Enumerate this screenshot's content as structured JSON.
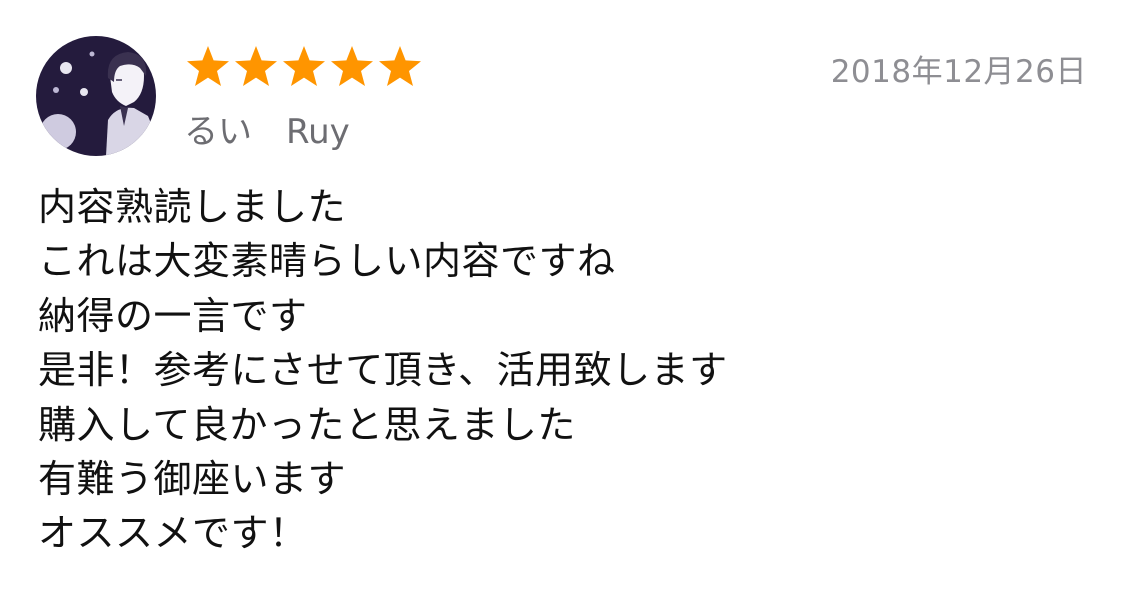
{
  "review": {
    "rating": 5,
    "rating_max": 5,
    "date": "2018年12月26日",
    "reviewer_name": "るい　Ruy",
    "lines": [
      "内容熟読しました",
      "これは大変素晴らしい内容ですね",
      "納得の一言です",
      "是非！参考にさせて頂き、活用致します",
      "購入して良かったと思えました",
      "有難う御座います",
      "オススメです！"
    ]
  },
  "colors": {
    "star": "#ff9500",
    "date": "#8e8e93",
    "reviewer": "#6d6d72",
    "text": "#111111",
    "avatar_bg": "#241b3d"
  },
  "icons": {
    "avatar": "user-avatar-illustration",
    "star": "star-filled-icon"
  }
}
